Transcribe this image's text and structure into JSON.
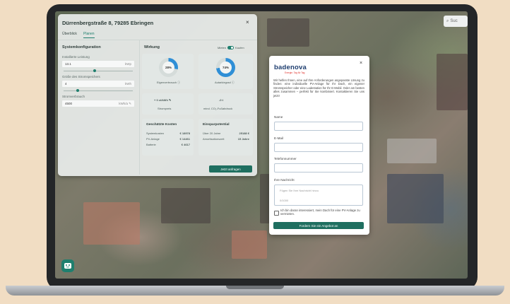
{
  "map": {
    "search_placeholder": "Suc"
  },
  "panel": {
    "title": "Dürrenbergstraße 8, 79285 Ebringen",
    "close_glyph": "×",
    "tabs": [
      "Überblick",
      "Planen"
    ],
    "system": {
      "title": "Systemkonfiguration",
      "power_label": "Installierte Leistung",
      "power_value": "13.1",
      "power_unit": "kWp",
      "storage_label": "Größe des Stromspeichers",
      "storage_value": "4",
      "storage_unit": "kWh",
      "consumption_label": "Stromverbrauch",
      "consumption_value": "4500",
      "consumption_unit": "kWh/a",
      "power_level": 0.45,
      "storage_level": 0.2
    },
    "effect": {
      "title": "Wirkung",
      "toggle_left": "Mieten",
      "toggle_right": "Kaufen",
      "self_consumption_pct": "28%",
      "self_consumption_level": 0.28,
      "self_consumption_label": "Eigenverbrauch",
      "autarky_pct": "74%",
      "autarky_level": 0.74,
      "autarky_label": "Autarkiegrad",
      "savings_value": "+ 0 ct/kWh",
      "savings_label": "Strompreis",
      "co2_value": "-0 t",
      "co2_label": "mind. CO₂-Fußabdruck"
    },
    "costs": {
      "title": "Geschätzte Kosten",
      "rows": [
        {
          "label": "Systemkosten",
          "value": "€ 18978"
        },
        {
          "label": "PV-Anlage",
          "value": "€ 14461"
        },
        {
          "label": "Batterie",
          "value": "€ 4617"
        }
      ]
    },
    "savings": {
      "title": "Einsparpotential",
      "rows": [
        {
          "label": "Über 20 Jahre",
          "value": "25188 €"
        },
        {
          "label": "Amortisationszeit",
          "value": "15 Jahre"
        }
      ]
    },
    "request_button": "Jetzt anfragen"
  },
  "modal": {
    "logo": "badenova",
    "tagline": "Energie. Tag für Tag",
    "close_glyph": "×",
    "intro": "Wir helfen Ihnen, eine auf Ihre Anforderungen angepasste Lösung zu finden: eine individuelle PV-Anlage für Ihr Dach, ein eigener Stromspeicher oder eine Ladestation für Ihr E-Mobil. Oder am besten alles zusammen – perfekt für Sie kombiniert. Kontaktieren Sie uns jetzt!",
    "fields": {
      "name_label": "Name",
      "email_label": "E-Mail",
      "phone_label": "Telefonnummer",
      "message_label": "Ihre Nachricht",
      "message_placeholder": "Fügen Sie Ihre Nachricht hinzu",
      "message_counter": "0/1000"
    },
    "checkbox_text": "Ich bin daran interessiert, mein Dach für eine PV-Anlage zu vermieten.",
    "submit": "Fordern Sie ein Angebot an"
  },
  "colors": {
    "accent": "#1f6f60",
    "donut": "#2f8fd6",
    "brand": "#1c3c6e"
  }
}
